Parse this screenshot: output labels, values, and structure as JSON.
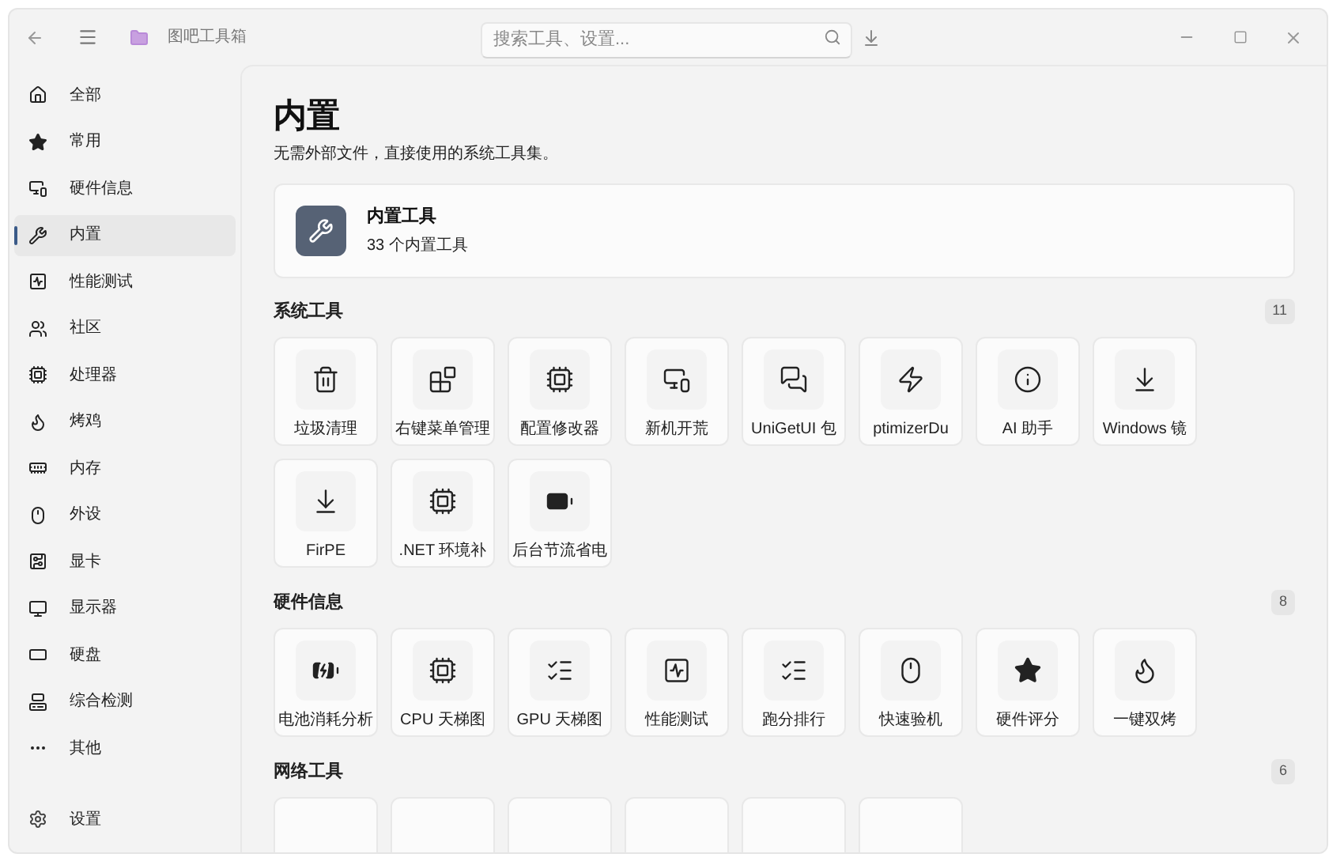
{
  "app_title": "图吧工具箱",
  "search": {
    "placeholder": "搜索工具、设置..."
  },
  "sidebar": {
    "items": [
      {
        "label": "全部",
        "selected": false
      },
      {
        "label": "常用",
        "selected": false
      },
      {
        "label": "硬件信息",
        "selected": false
      },
      {
        "label": "内置",
        "selected": true
      },
      {
        "label": "性能测试",
        "selected": false
      },
      {
        "label": "社区",
        "selected": false
      },
      {
        "label": "处理器",
        "selected": false
      },
      {
        "label": "烤鸡",
        "selected": false
      },
      {
        "label": "内存",
        "selected": false
      },
      {
        "label": "外设",
        "selected": false
      },
      {
        "label": "显卡",
        "selected": false
      },
      {
        "label": "显示器",
        "selected": false
      },
      {
        "label": "硬盘",
        "selected": false
      },
      {
        "label": "综合检测",
        "selected": false
      },
      {
        "label": "其他",
        "selected": false
      }
    ],
    "settings": "设置"
  },
  "page": {
    "title": "内置",
    "subtitle": "无需外部文件，直接使用的系统工具集。"
  },
  "summary_card": {
    "title": "内置工具",
    "count": "33 个内置工具"
  },
  "sections": [
    {
      "title": "系统工具",
      "count": "11",
      "tools": [
        {
          "label": "垃圾清理"
        },
        {
          "label": "右键菜单管理"
        },
        {
          "label": "配置修改器"
        },
        {
          "label": "新机开荒"
        },
        {
          "label": "UniGetUI 包"
        },
        {
          "label": "ptimizerDu"
        },
        {
          "label": "AI 助手"
        },
        {
          "label": "Windows 镜"
        },
        {
          "label": "FirPE"
        },
        {
          "label": ".NET 环境补"
        },
        {
          "label": "后台节流省电"
        }
      ]
    },
    {
      "title": "硬件信息",
      "count": "8",
      "tools": [
        {
          "label": "电池消耗分析"
        },
        {
          "label": "CPU 天梯图"
        },
        {
          "label": "GPU 天梯图"
        },
        {
          "label": "性能测试"
        },
        {
          "label": "跑分排行"
        },
        {
          "label": "快速验机"
        },
        {
          "label": "硬件评分"
        },
        {
          "label": "一键双烤"
        }
      ]
    },
    {
      "title": "网络工具",
      "count": "6"
    }
  ]
}
